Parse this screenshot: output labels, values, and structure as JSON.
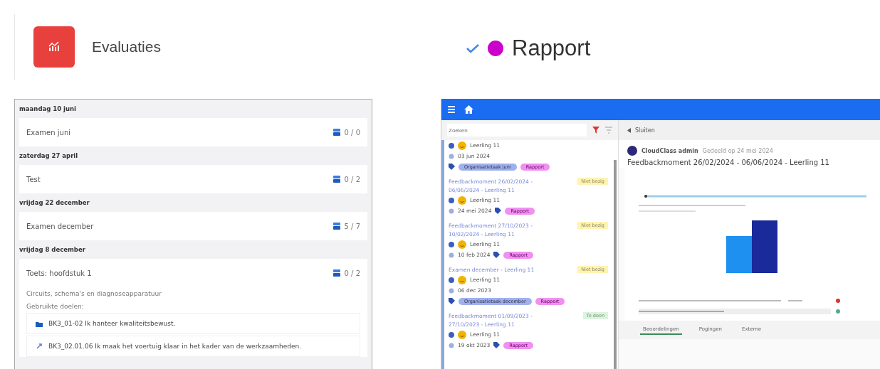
{
  "header": {
    "app": {
      "title": "Evaluaties"
    },
    "report": {
      "title": "Rapport",
      "checked": true,
      "color": "#cc00cc"
    }
  },
  "evaluations": [
    {
      "date": "maandag 10 juni",
      "items": [
        {
          "title": "Examen juni",
          "count": "0 / 0"
        }
      ]
    },
    {
      "date": "zaterdag 27 april",
      "items": [
        {
          "title": "Test",
          "count": "0 / 2"
        }
      ]
    },
    {
      "date": "vrijdag 22 december",
      "items": [
        {
          "title": "Examen december",
          "count": "5 / 7"
        }
      ]
    },
    {
      "date": "vrijdag 8 december",
      "items": [
        {
          "title": "Toets: hoofdstuk 1",
          "count": "0 / 2",
          "description": "Circuits, schema's en diagnoseapparatuur",
          "goals_label": "Gebruikte doelen:",
          "goals": [
            {
              "kind": "folder",
              "text": "BK3_01-02 Ik hanteer kwaliteitsbewust."
            },
            {
              "kind": "link",
              "text": "BK3_02.01.06 Ik maak het voertuig klaar in het kader van de werkzaamheden."
            }
          ]
        }
      ]
    }
  ],
  "report_app": {
    "search": {
      "placeholder": "Zoeken"
    },
    "list": [
      {
        "student": "Leerling 11",
        "date": "03 jun 2024",
        "tags": [
          {
            "kind": "group",
            "label": "Organisatietaak juni"
          },
          {
            "kind": "report",
            "label": "Rapport"
          }
        ]
      },
      {
        "title": "Feedbackmoment 26/02/2024 - 06/06/2024 - Leerling 11",
        "status": {
          "label": "Niet bezig",
          "color": "#fff3b0"
        },
        "student": "Leerling 11",
        "date": "24 mei 2024",
        "tags": [
          {
            "kind": "report",
            "label": "Rapport"
          }
        ]
      },
      {
        "title": "Feedbackmoment 27/10/2023 - 10/02/2024 - Leerling 11",
        "status": {
          "label": "Niet bezig",
          "color": "#fff3b0"
        },
        "student": "Leerling 11",
        "date": "10 feb 2024",
        "tags": [
          {
            "kind": "report",
            "label": "Rapport"
          }
        ]
      },
      {
        "title": "Examen december - Leerling 11",
        "status": {
          "label": "Niet bezig",
          "color": "#fff3b0"
        },
        "student": "Leerling 11",
        "date": "06 dec 2023",
        "tags": [
          {
            "kind": "group",
            "label": "Organisatietaak december"
          },
          {
            "kind": "report",
            "label": "Rapport"
          }
        ]
      },
      {
        "title": "Feedbackmoment 01/09/2023 - 27/10/2023 - Leerling 11",
        "status": {
          "label": "Te doen",
          "color": "#d8f5e0"
        },
        "student": "Leerling 11",
        "date": "19 okt 2023",
        "tags": [
          {
            "kind": "report",
            "label": "Rapport"
          }
        ]
      }
    ],
    "detail": {
      "back": "Sluiten",
      "author": "CloudClass admin",
      "shared": "Gedeeld op 24 mei 2024",
      "title": "Feedbackmoment 26/02/2024 - 06/06/2024 - Leerling 11",
      "tabs": [
        {
          "label": "Beoordelingen",
          "selected": true
        },
        {
          "label": "Pogingen",
          "selected": false
        },
        {
          "label": "Externe",
          "selected": false
        }
      ]
    }
  }
}
